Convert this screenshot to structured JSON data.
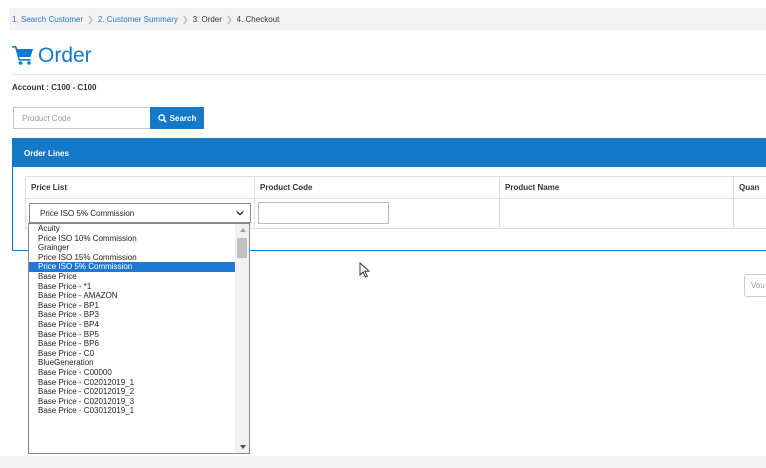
{
  "breadcrumb": [
    {
      "label": "1. Search Customer"
    },
    {
      "label": "2. Customer Summary"
    },
    {
      "label": "3. Order"
    },
    {
      "label": "4. Checkout"
    }
  ],
  "page": {
    "title": "Order",
    "account": "Account : C100 - C100"
  },
  "search": {
    "placeholder": "Product Code",
    "button_label": "Search"
  },
  "order_lines": {
    "header": "Order Lines",
    "columns": [
      "Price List",
      "Product Code",
      "Product Name",
      "Quan"
    ],
    "selected_price_list": "Price ISO 5% Commission"
  },
  "price_list_options": [
    "Acuity",
    "Price ISO 10% Commission",
    "Grainger",
    "Price ISO 15% Commission",
    "Price ISO 5% Commission",
    "Base Price",
    "Base Price - *1",
    "Base Price - AMAZON",
    "Base Price - BP1",
    "Base Price - BP3",
    "Base Price - BP4",
    "Base Price - BP5",
    "Base Price - BP6",
    "Base Price - C0",
    "BlueGeneration",
    "Base Price - C00000",
    "Base Price - C02012019_1",
    "Base Price - C02012019_2",
    "Base Price - C02012019_3",
    "Base Price - C03012019_1"
  ],
  "selected_option_index": 4,
  "right_button": {
    "label": "Vou"
  },
  "colors": {
    "accent": "#1479c9",
    "selected": "#1e79d6"
  }
}
